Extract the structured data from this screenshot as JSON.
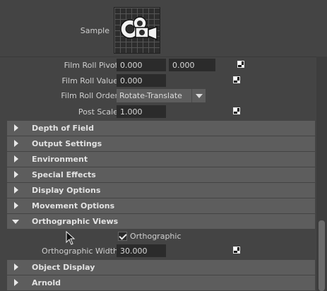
{
  "sample": {
    "label": "Sample",
    "icon": "sample-swatch-icon"
  },
  "film_roll": {
    "pivot": {
      "label": "Film Roll Pivot",
      "x": "0.000",
      "y": "0.000"
    },
    "value": {
      "label": "Film Roll Value",
      "value": "0.000"
    },
    "order": {
      "label": "Film Roll Order",
      "selected": "Rotate-Translate"
    },
    "post_scale": {
      "label": "Post Scale",
      "value": "1.000"
    }
  },
  "sections": [
    {
      "label": "Depth of Field",
      "expanded": false
    },
    {
      "label": "Output Settings",
      "expanded": false
    },
    {
      "label": "Environment",
      "expanded": false
    },
    {
      "label": "Special Effects",
      "expanded": false
    },
    {
      "label": "Display Options",
      "expanded": false
    },
    {
      "label": "Movement Options",
      "expanded": false
    },
    {
      "label": "Orthographic Views",
      "expanded": true
    },
    {
      "label": "Object Display",
      "expanded": false
    },
    {
      "label": "Arnold",
      "expanded": false
    }
  ],
  "orthographic": {
    "checkbox_label": "Orthographic",
    "checked": true,
    "width_label": "Orthographic Width",
    "width_value": "30.000"
  },
  "colors": {
    "background": "#444444",
    "section_bar": "#5d5d5d",
    "field": "#2b2b2b"
  }
}
